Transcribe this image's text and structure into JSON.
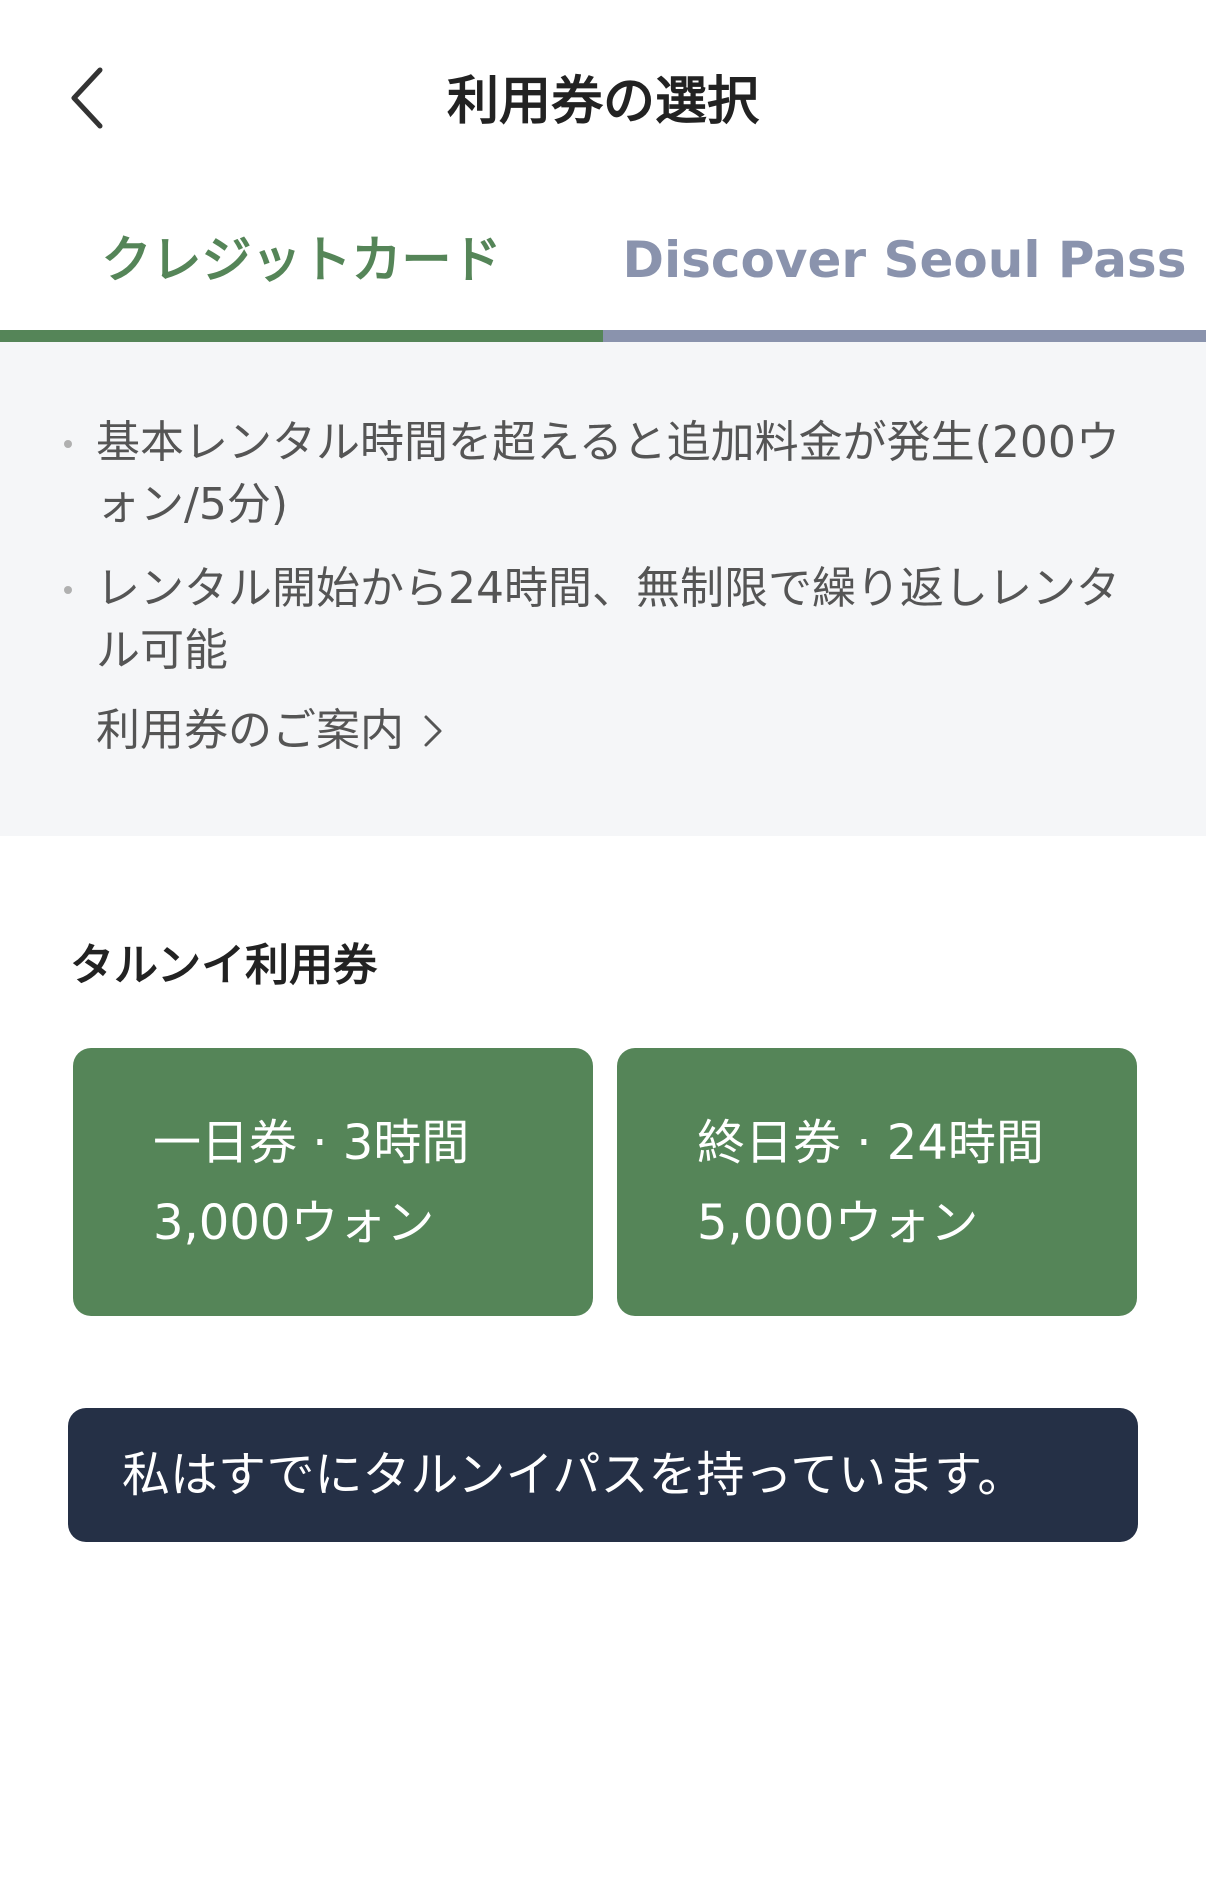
{
  "header": {
    "title": "利用券の選択",
    "back_icon": "chevron-left-icon"
  },
  "tabs": [
    {
      "label": "クレジットカード",
      "active": true
    },
    {
      "label": "Discover Seoul Pass",
      "active": false
    }
  ],
  "colors": {
    "accent_green": "#558558",
    "inactive_tab": "#8a93ad",
    "dark_button": "#253046",
    "panel_bg": "#f5f6f8"
  },
  "info": {
    "items": [
      "基本レンタル時間を超えると追加料金が発生(200ウォン/5分)",
      "レンタル開始から24時間、無制限で繰り返しレンタル可能"
    ],
    "guide_link": "利用券のご案内"
  },
  "section": {
    "title": "タルンイ利用券"
  },
  "tickets": [
    {
      "name": "一日券 · 3時間",
      "price": "3,000ウォン"
    },
    {
      "name": "終日券 · 24時間",
      "price": "5,000ウォン"
    }
  ],
  "pass_button": {
    "label": "私はすでにタルンイパスを持っています。"
  }
}
